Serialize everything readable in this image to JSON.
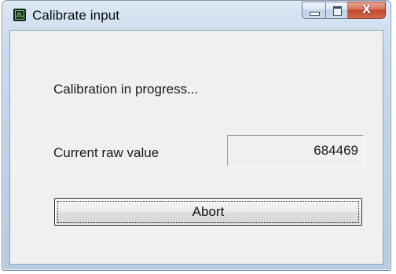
{
  "window": {
    "title": "Calibrate input",
    "icon": "app-window-icon",
    "caption_buttons": {
      "minimize_icon": "minimize-icon",
      "maximize_icon": "maximize-icon",
      "close_icon": "close-icon",
      "close_glyph": "X"
    }
  },
  "dialog": {
    "status_text": "Calibration in progress...",
    "raw_value_label": "Current raw value",
    "raw_value": "684469",
    "abort_label": "Abort"
  },
  "colors": {
    "title_bar": "#c9dbee",
    "close_button": "#c3452b",
    "client_background": "#f0f0f0"
  }
}
